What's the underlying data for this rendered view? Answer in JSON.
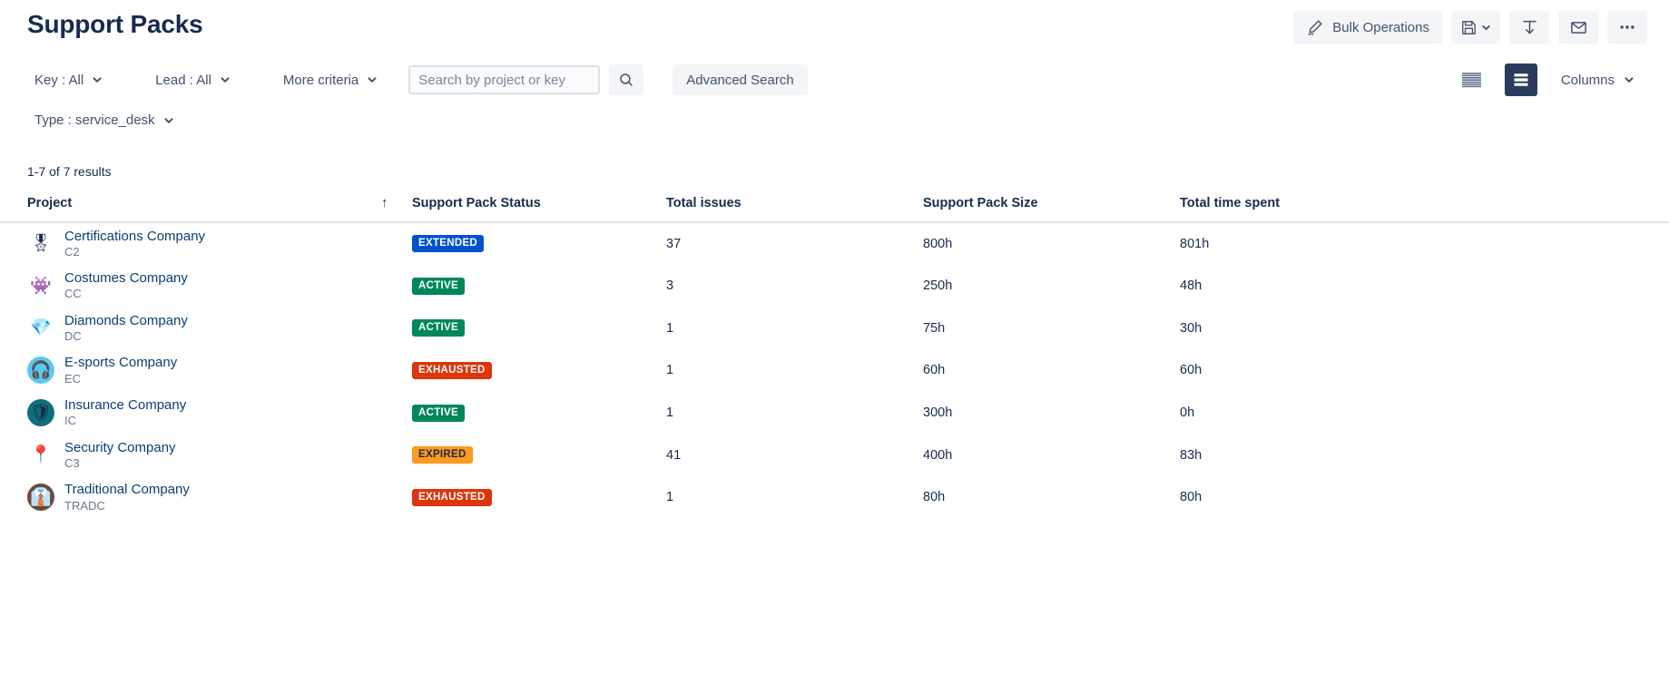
{
  "header": {
    "title": "Support Packs",
    "actions": [
      {
        "id": "bulk-operations",
        "label": "Bulk Operations",
        "icon": "pencil-icon"
      },
      {
        "id": "save-filter",
        "label": "",
        "icon": "save-icon",
        "has_chevron": true
      },
      {
        "id": "import",
        "label": "",
        "icon": "download-icon"
      },
      {
        "id": "email",
        "label": "",
        "icon": "envelope-icon"
      },
      {
        "id": "more",
        "label": "",
        "icon": "more-horizontal-icon"
      }
    ]
  },
  "filters": {
    "key": "Key : All",
    "lead": "Lead : All",
    "more_criteria": "More criteria",
    "type": "Type : service_desk",
    "search": {
      "value": "",
      "placeholder": "Search by project or key"
    },
    "advanced_search": "Advanced Search",
    "columns": "Columns"
  },
  "results": {
    "count_label": "1-7 of 7 results"
  },
  "table": {
    "columns": [
      {
        "key": "project",
        "label": "Project",
        "sorted": true,
        "sort_direction": "↑"
      },
      {
        "key": "status",
        "label": "Support Pack Status"
      },
      {
        "key": "issues",
        "label": "Total issues"
      },
      {
        "key": "size",
        "label": "Support Pack Size"
      },
      {
        "key": "time",
        "label": "Total time spent"
      }
    ],
    "rows": [
      {
        "project": "Certifications Company",
        "key": "C2",
        "avatar_icon": "rosette-medal-icon",
        "avatar_glyph": "🎖",
        "avatar_bg": "#FFFFFF",
        "status": "EXTENDED",
        "status_bg": "#0052CC",
        "status_fg": "#FFFFFF",
        "issues": "37",
        "size": "800h",
        "time": "801h"
      },
      {
        "project": "Costumes Company",
        "key": "CC",
        "avatar_icon": "robot-costume-icon",
        "avatar_glyph": "👾",
        "avatar_bg": "#FFFFFF",
        "status": "ACTIVE",
        "status_bg": "#00875A",
        "status_fg": "#FFFFFF",
        "issues": "3",
        "size": "250h",
        "time": "48h"
      },
      {
        "project": "Diamonds Company",
        "key": "DC",
        "avatar_icon": "diamond-icon",
        "avatar_glyph": "💎",
        "avatar_bg": "#FFFFFF",
        "status": "ACTIVE",
        "status_bg": "#00875A",
        "status_fg": "#FFFFFF",
        "issues": "1",
        "size": "75h",
        "time": "30h"
      },
      {
        "project": "E-sports Company",
        "key": "EC",
        "avatar_icon": "headset-gamer-icon",
        "avatar_glyph": "🎧",
        "avatar_bg": "#5BC8EC",
        "status": "EXHAUSTED",
        "status_bg": "#DE350B",
        "status_fg": "#FFFFFF",
        "issues": "1",
        "size": "60h",
        "time": "60h"
      },
      {
        "project": "Insurance Company",
        "key": "IC",
        "avatar_icon": "shield-icon",
        "avatar_glyph": "🛡",
        "avatar_bg": "#0E6E7E",
        "status": "ACTIVE",
        "status_bg": "#00875A",
        "status_fg": "#FFFFFF",
        "issues": "1",
        "size": "300h",
        "time": "0h"
      },
      {
        "project": "Security Company",
        "key": "C3",
        "avatar_icon": "map-pin-lock-icon",
        "avatar_glyph": "📍",
        "avatar_bg": "#FFFFFF",
        "status": "EXPIRED",
        "status_bg": "#FF991F",
        "status_fg": "#172B4D",
        "issues": "41",
        "size": "400h",
        "time": "83h"
      },
      {
        "project": "Traditional Company",
        "key": "TRADC",
        "avatar_icon": "business-suit-icon",
        "avatar_glyph": "👔",
        "avatar_bg": "#6B4A3A",
        "status": "EXHAUSTED",
        "status_bg": "#DE350B",
        "status_fg": "#FFFFFF",
        "issues": "1",
        "size": "80h",
        "time": "80h"
      }
    ]
  },
  "view": {
    "compact_label": "",
    "detail_label": "",
    "selected": "detail"
  },
  "colors": {
    "title": "#172B4D",
    "muted": "#6B778C",
    "button_bg": "#F4F5F7",
    "selected_toggle": "#2B3C5B",
    "link": "#0B3E73"
  }
}
